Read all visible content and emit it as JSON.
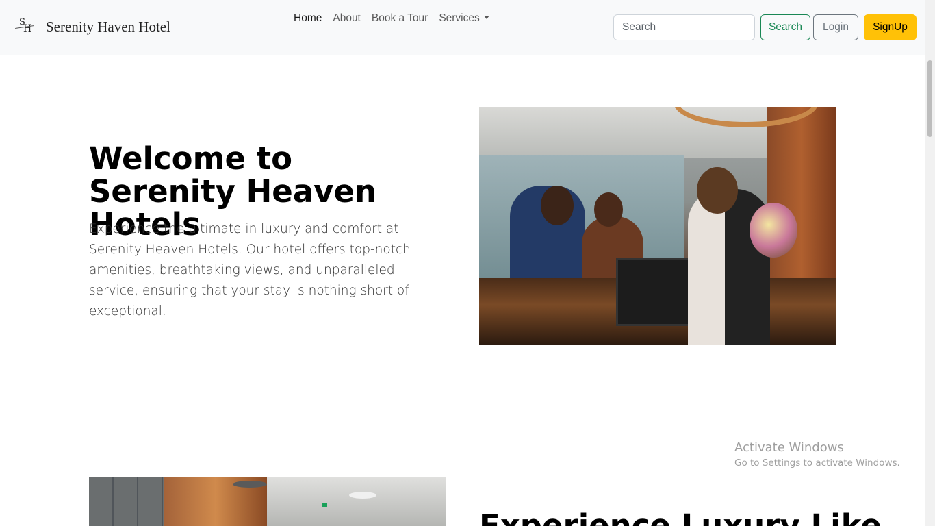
{
  "brand": {
    "logo_letters": "SH",
    "name": "Serenity Haven Hotel"
  },
  "nav": {
    "items": [
      {
        "label": "Home",
        "active": true
      },
      {
        "label": "About"
      },
      {
        "label": "Book a Tour"
      },
      {
        "label": "Services",
        "dropdown": true
      }
    ]
  },
  "search": {
    "placeholder": "Search",
    "value": "",
    "button_label": "Search"
  },
  "auth": {
    "login_label": "Login",
    "signup_label": "SignUp"
  },
  "hero": {
    "title": "Welcome to Serenity Heaven Hotels",
    "description": "Experience the ultimate in luxury and comfort at Serenity Heaven Hotels. Our hotel offers top-notch amenities, breathtaking views, and unparalleled service, ensuring that your stay is nothing short of exceptional.",
    "image_subject": "guests at hotel reception desk"
  },
  "section2": {
    "title": "Experience Luxury Like",
    "image_subject": "hotel lobby interior"
  },
  "watermark": {
    "title": "Activate Windows",
    "subtitle": "Go to Settings to activate Windows."
  },
  "colors": {
    "navbar_bg": "#f8f9fa",
    "search_btn": "#198754",
    "login_btn": "#6c757d",
    "signup_btn": "#ffc107"
  }
}
